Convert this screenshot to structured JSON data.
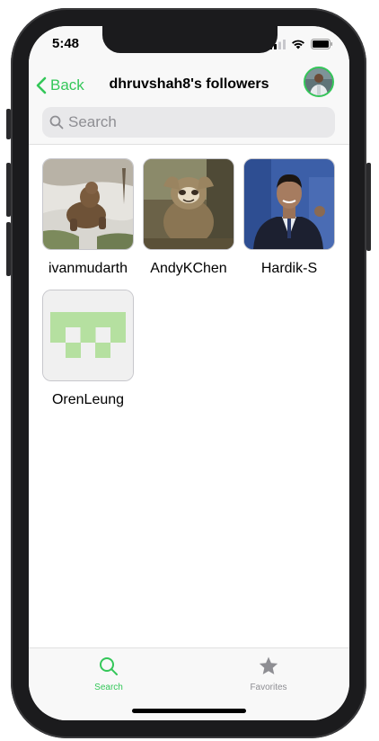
{
  "status_bar": {
    "time": "5:48"
  },
  "nav": {
    "back_label": "Back",
    "title": "dhruvshah8's followers"
  },
  "search": {
    "placeholder": "Search",
    "value": ""
  },
  "followers": [
    {
      "username": "ivanmudarth"
    },
    {
      "username": "AndyKChen"
    },
    {
      "username": "Hardik-S"
    },
    {
      "username": "OrenLeung"
    }
  ],
  "tab_bar": {
    "tabs": [
      {
        "label": "Search",
        "icon": "search-icon",
        "active": true
      },
      {
        "label": "Favorites",
        "icon": "star-icon",
        "active": false
      }
    ]
  },
  "colors": {
    "accent": "#34c759",
    "inactive": "#8e8e93"
  }
}
